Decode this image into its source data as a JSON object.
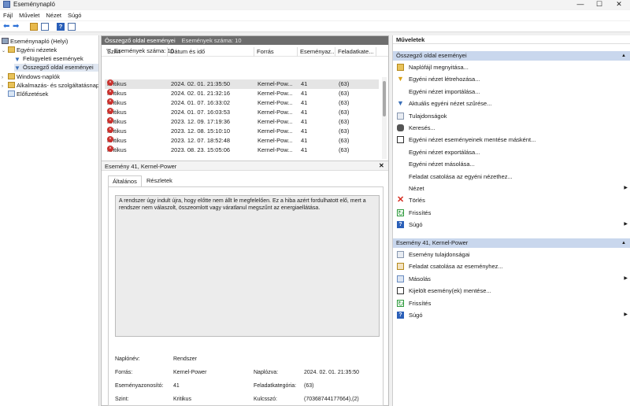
{
  "window": {
    "title": "Eseménynapló",
    "minimize": "—",
    "maximize": "☐",
    "close": "✕"
  },
  "menu": [
    "Fájl",
    "Művelet",
    "Nézet",
    "Súgó"
  ],
  "tree": [
    {
      "label": "Eseménynapló (Helyi)",
      "icon": "computer-icon"
    },
    {
      "label": "Egyéni nézetek",
      "icon": "folder-icon",
      "expanded": true
    },
    {
      "label": "Felügyeleti események",
      "icon": "filter-icon"
    },
    {
      "label": "Összegző oldal eseményei",
      "icon": "filter-icon",
      "selected": true
    },
    {
      "label": "Windows-naplók",
      "icon": "folder-icon"
    },
    {
      "label": "Alkalmazás- és szolgáltatásnaplók",
      "icon": "folder-icon"
    },
    {
      "label": "Előfizetések",
      "icon": "subscription-icon"
    }
  ],
  "center": {
    "title": "Összegző oldal eseményei",
    "count_label": "Események száma: 10",
    "filter_label": "Események száma: 10",
    "columns": [
      "Szint",
      "Dátum és idő",
      "Forrás",
      "Eseményaz...",
      "Feladatkate..."
    ],
    "rows": [
      {
        "level": "Kritikus",
        "date": "2024. 02. 01. 21:35:50",
        "source": "Kernel-Pow...",
        "id": "41",
        "task": "(63)"
      },
      {
        "level": "Kritikus",
        "date": "2024. 02. 01. 21:32:16",
        "source": "Kernel-Pow...",
        "id": "41",
        "task": "(63)"
      },
      {
        "level": "Kritikus",
        "date": "2024. 01. 07. 16:33:02",
        "source": "Kernel-Pow...",
        "id": "41",
        "task": "(63)"
      },
      {
        "level": "Kritikus",
        "date": "2024. 01. 07. 16:03:53",
        "source": "Kernel-Pow...",
        "id": "41",
        "task": "(63)"
      },
      {
        "level": "Kritikus",
        "date": "2023. 12. 09. 17:19:36",
        "source": "Kernel-Pow...",
        "id": "41",
        "task": "(63)"
      },
      {
        "level": "Kritikus",
        "date": "2023. 12. 08. 15:10:10",
        "source": "Kernel-Pow...",
        "id": "41",
        "task": "(63)"
      },
      {
        "level": "Kritikus",
        "date": "2023. 12. 07. 18:52:48",
        "source": "Kernel-Pow...",
        "id": "41",
        "task": "(63)"
      },
      {
        "level": "Kritikus",
        "date": "2023. 08. 23. 15:05:06",
        "source": "Kernel-Pow...",
        "id": "41",
        "task": "(63)"
      }
    ],
    "detail_title": "Esemény 41, Kernel-Power",
    "detail_close": "✕",
    "tabs": [
      "Általános",
      "Részletek"
    ],
    "message": "A rendszer úgy indult újra, hogy előtte nem állt le megfelelően. Ez a hiba azért fordulhatott elő, mert a rendszer nem válaszolt, összeomlott vagy váratlanul megszűnt az energiaellátása.",
    "props": {
      "log_name_label": "Naplónév:",
      "log_name": "Rendszer",
      "source_label": "Forrás:",
      "source": "Kernel-Power",
      "logged_label": "Naplózva:",
      "logged": "2024. 02. 01. 21:35:50",
      "event_id_label": "Eseményazonosító:",
      "event_id": "41",
      "task_label": "Feladatkategória:",
      "task": "(63)",
      "level_label": "Szint:",
      "level": "Kritikus",
      "keywords_label": "Kulcsszó:",
      "keywords": "(70368744177664),(2)"
    }
  },
  "actions": {
    "title": "Műveletek",
    "section1": "Összegző oldal eseményei",
    "items1": [
      {
        "label": "Naplófájl megnyitása...",
        "icon": "open-folder-icon"
      },
      {
        "label": "Egyéni nézet létrehozása...",
        "icon": "create-filter-icon"
      },
      {
        "label": "Egyéni nézet importálása...",
        "icon": ""
      },
      {
        "label": "Aktuális egyéni nézet szűrése...",
        "icon": "filter-icon"
      },
      {
        "label": "Tulajdonságok",
        "icon": "properties-icon"
      },
      {
        "label": "Keresés...",
        "icon": "binoculars-icon"
      },
      {
        "label": "Egyéni nézet eseményeinek mentése másként...",
        "icon": "save-icon"
      },
      {
        "label": "Egyéni nézet exportálása...",
        "icon": ""
      },
      {
        "label": "Egyéni nézet másolása...",
        "icon": ""
      },
      {
        "label": "Feladat csatolása az egyéni nézethez...",
        "icon": ""
      },
      {
        "label": "Nézet",
        "icon": "",
        "submenu": true
      },
      {
        "label": "Törlés",
        "icon": "delete-icon"
      },
      {
        "label": "Frissítés",
        "icon": "refresh-icon"
      },
      {
        "label": "Súgó",
        "icon": "help-icon",
        "submenu": true
      }
    ],
    "section2": "Esemény 41, Kernel-Power",
    "items2": [
      {
        "label": "Esemény tulajdonságai",
        "icon": "event-properties-icon"
      },
      {
        "label": "Feladat csatolása az eseményhez...",
        "icon": "task-icon"
      },
      {
        "label": "Másolás",
        "icon": "copy-icon",
        "submenu": true
      },
      {
        "label": "Kijelölt esemény(ek) mentése...",
        "icon": "save-icon"
      },
      {
        "label": "Frissítés",
        "icon": "refresh-icon"
      },
      {
        "label": "Súgó",
        "icon": "help-icon",
        "submenu": true
      }
    ]
  },
  "colors": {
    "critical": "#c9302c",
    "section_bg": "#c9d7ed",
    "header_bg": "#6d6d6d"
  }
}
